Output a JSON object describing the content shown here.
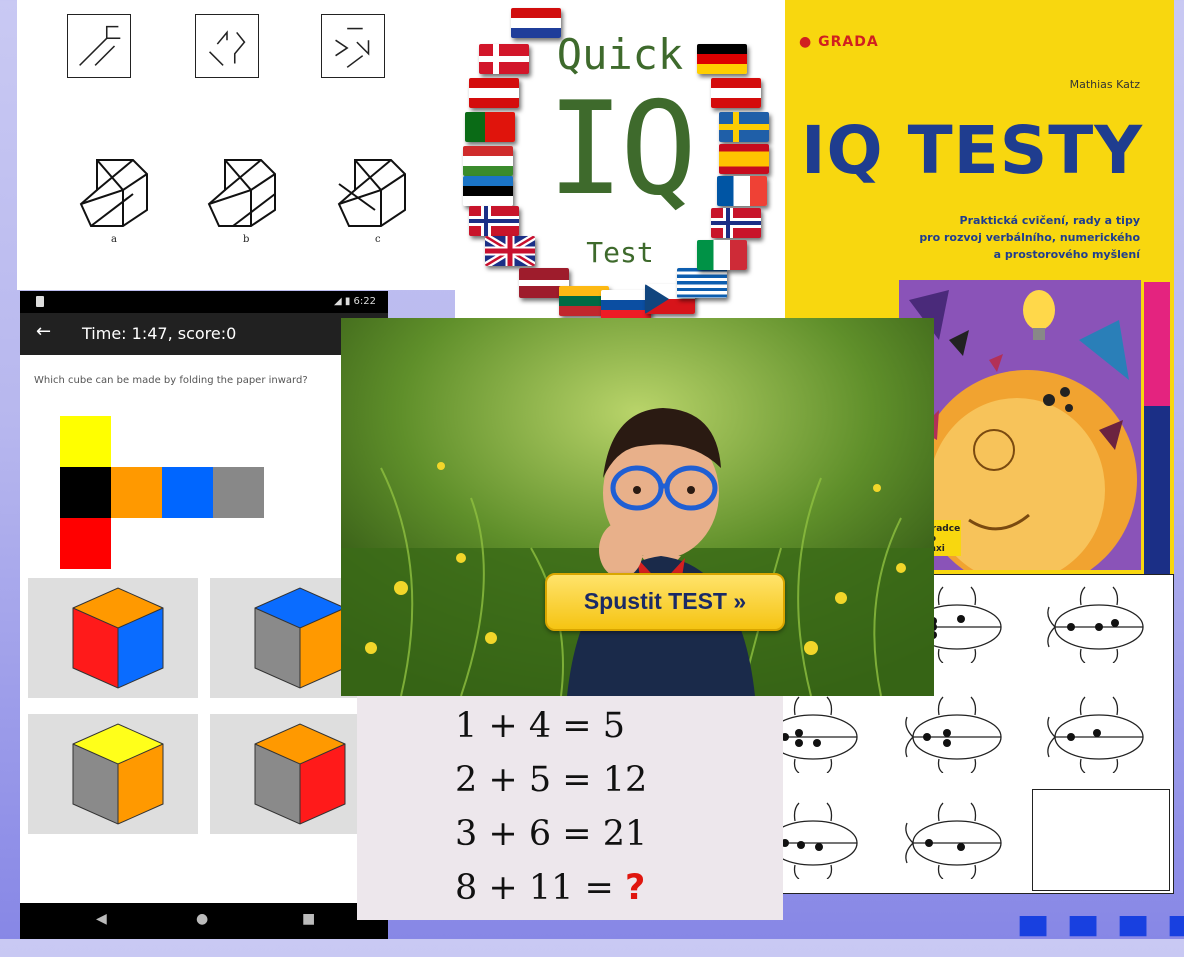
{
  "puzzle": {
    "labels": [
      "a",
      "b",
      "c"
    ]
  },
  "quick_iq": {
    "line1": "Quick",
    "line2": "IQ",
    "line3": "Test"
  },
  "book": {
    "publisher": "GRADA",
    "author": "Mathias Katz",
    "title": "IQ TESTY",
    "subtitle_lines": [
      "Praktická cvičení, rady a tipy",
      "pro rozvoj verbálního, numerického",
      "a prostorového myšlení"
    ],
    "series_lines": [
      "Poradce",
      "pro praxi"
    ],
    "colors": {
      "cover": "#f8d70f",
      "title": "#1f3d8f",
      "accent_pink": "#e4237f"
    }
  },
  "phone": {
    "status_time": "6:22",
    "back_icon": "arrow-left-icon",
    "app_title": "Time: 1:47, score:0",
    "question": "Which cube can be made by folding the paper inward?",
    "net_colors": [
      "#ffff00",
      "#000000",
      "#ff9900",
      "#0066ff",
      "#888888",
      "#ff0000"
    ],
    "nav_icons": [
      "back-triangle-icon",
      "home-circle-icon",
      "recents-square-icon"
    ]
  },
  "photo": {
    "button_label": "Spustit TEST »"
  },
  "math": {
    "equations": [
      "1 + 4 = 5",
      "2 + 5 = 12",
      "3 + 6 = 21"
    ],
    "last_prefix": "8 + 11 = ",
    "last_answer": "?"
  }
}
